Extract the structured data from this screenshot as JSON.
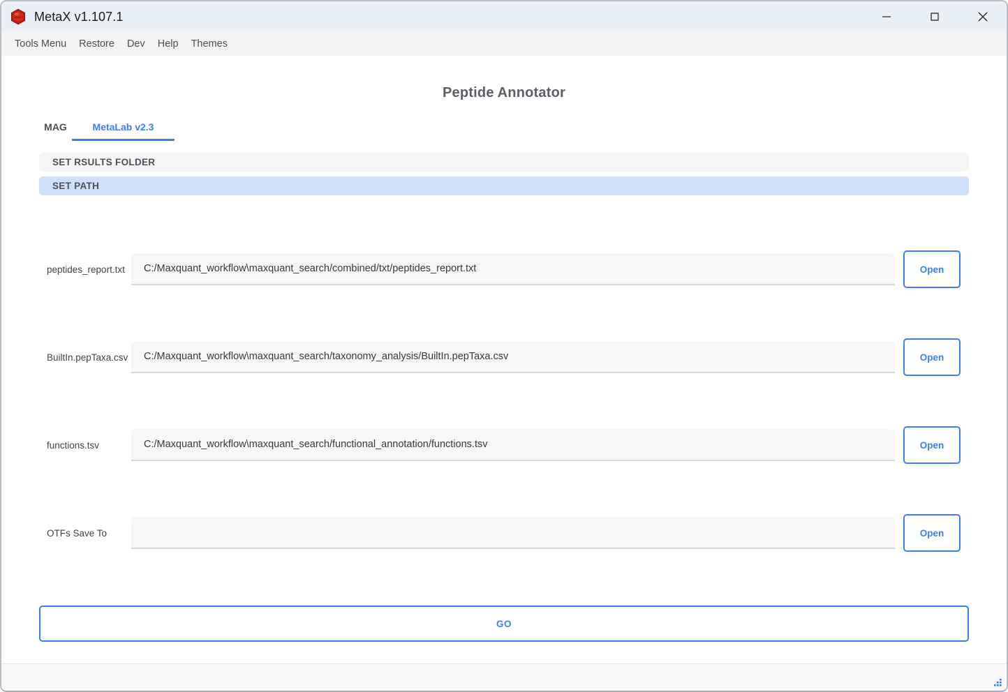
{
  "window": {
    "title": "MetaX v1.107.1",
    "logo_icon": "metax-hexagon-logo",
    "controls": {
      "minimize": "minimize-icon",
      "maximize": "maximize-icon",
      "close": "close-icon"
    }
  },
  "menubar": {
    "items": [
      {
        "label": "Tools Menu"
      },
      {
        "label": "Restore"
      },
      {
        "label": "Dev"
      },
      {
        "label": "Help"
      },
      {
        "label": "Themes"
      }
    ]
  },
  "main": {
    "page_title": "Peptide Annotator",
    "tabs": [
      {
        "label": "MAG",
        "active": false
      },
      {
        "label": "MetaLab v2.3",
        "active": true
      }
    ],
    "sections": [
      {
        "label": "SET RSULTS FOLDER",
        "active": false
      },
      {
        "label": "SET PATH",
        "active": true
      }
    ],
    "rows": [
      {
        "label": "peptides_report.txt",
        "value": "C:/Maxquant_workflow\\maxquant_search/combined/txt/peptides_report.txt",
        "placeholder": "",
        "button": "Open"
      },
      {
        "label": "BuiltIn.pepTaxa.csv",
        "value": "C:/Maxquant_workflow\\maxquant_search/taxonomy_analysis/BuiltIn.pepTaxa.csv",
        "placeholder": "",
        "button": "Open"
      },
      {
        "label": "functions.tsv",
        "value": "C:/Maxquant_workflow\\maxquant_search/functional_annotation/functions.tsv",
        "placeholder": "",
        "button": "Open"
      },
      {
        "label": "OTFs Save To",
        "value": "",
        "placeholder": "",
        "button": "Open"
      }
    ],
    "go_label": "GO"
  },
  "statusbar": {
    "resize_grip_icon": "resize-grip-icon"
  },
  "colors": {
    "accent": "#3d7ff3",
    "titlebar_bg": "#e9f1f7",
    "menubar_bg": "#f3f3f4",
    "section_plain_bg": "#f5f5f6",
    "section_active_bg": "#cfe0fa",
    "field_bg": "#f7f7f8",
    "logo_red": "#b51f14"
  }
}
